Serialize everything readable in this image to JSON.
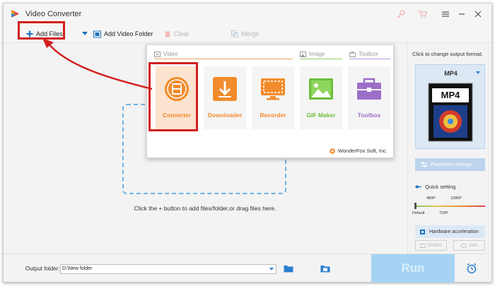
{
  "app": {
    "title": "Video Converter",
    "logo_icon": "app-logo-icon"
  },
  "titlebar": {
    "icons": [
      "key-icon",
      "cart-icon",
      "menu-icon",
      "minimize-icon",
      "close-icon"
    ]
  },
  "toolbar": {
    "add_files": "Add Files",
    "add_video_folder": "Add Video Folder",
    "clear": "Clear",
    "merge": "Merge"
  },
  "popup": {
    "sections": {
      "video": "Video",
      "image": "Image",
      "toolbox": "Toolbox"
    },
    "cards": [
      {
        "label": "Converter",
        "icon": "film-reel-icon",
        "color": "#f28b2c"
      },
      {
        "label": "Downloader",
        "icon": "download-icon",
        "color": "#f28b2c"
      },
      {
        "label": "Recorder",
        "icon": "screen-record-icon",
        "color": "#f28b2c"
      },
      {
        "label": "GIF Maker",
        "icon": "image-icon",
        "color": "#6cbd3b"
      },
      {
        "label": "Toolbox",
        "icon": "toolbox-icon",
        "color": "#9b6ec8"
      }
    ],
    "brand": "WonderFox Soft, Inc."
  },
  "main": {
    "hint": "Click the + button to add files/folder,or drag files here."
  },
  "right_panel": {
    "title": "Click to change output format:",
    "format": "MP4",
    "format_thumb_text": "MP4",
    "parameter_settings": "Parameter settings",
    "quick_setting": "Quick setting",
    "ticks": {
      "t480": "480P",
      "t1080": "1080P",
      "default": "Default",
      "t720": "720P"
    },
    "hardware_acceleration": "Hardware acceleration",
    "nvidia": "NVIDIA",
    "intel": "Intel"
  },
  "bottom": {
    "output_label": "Output folder:",
    "output_value": "D:\\New folder",
    "run": "Run"
  },
  "colors": {
    "accent": "#d21f1f",
    "brand_orange": "#f28b2c",
    "run_bg": "#a6d3f3"
  }
}
